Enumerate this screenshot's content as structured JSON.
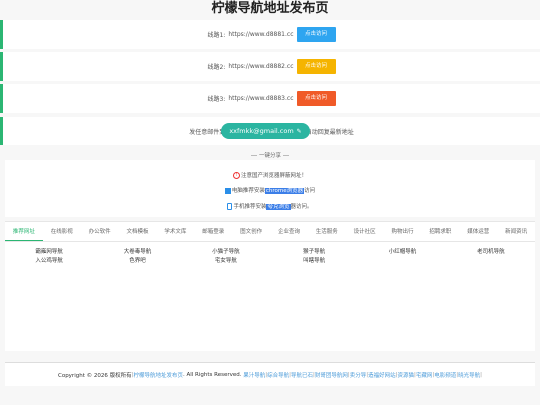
{
  "page_title": "柠檬导航地址发布页",
  "lines": [
    {
      "label": "线路1:",
      "url": "https://www.d8881.cc",
      "button": "点击访问",
      "color": "#2ea5f0"
    },
    {
      "label": "线路2:",
      "url": "https://www.d8882.cc",
      "button": "点击访问",
      "color": "#f5b400"
    },
    {
      "label": "线路3:",
      "url": "https://www.d8883.cc",
      "button": "点击访问",
      "color": "#f05a28"
    }
  ],
  "email": {
    "prefix": "发任意邮件到",
    "address": "xxfmkk@gmail.com",
    "suffix": "自动回复最新地址"
  },
  "share": {
    "title": "一键分享",
    "notice": "注意国产浏览器屏蔽网址！",
    "pc_prefix": "电脑推荐安装",
    "pc_browser": "chrome浏览器",
    "pc_suffix": "访问",
    "phone_prefix": "手机推荐安装",
    "phone_browser": "夸克浏览",
    "phone_suffix": "器访问。"
  },
  "tabs": [
    "推荐网址",
    "在线影视",
    "办公软件",
    "文档模板",
    "学术文库",
    "邮箱登录",
    "图文创作",
    "企业查询",
    "生活服务",
    "设计社区",
    "购物出行",
    "招聘求职",
    "媒体运营",
    "新闻资讯"
  ],
  "links": [
    "霸雍网导航",
    "大卷毒导航",
    "小猫子导航",
    "猴子导航",
    "小红帽导航",
    "老司机导航",
    "入公鸡导航",
    "色界吧",
    "宅女导航",
    "叫瞎导航"
  ],
  "footer": {
    "copyright": "Copyright © 2026 版权所有",
    "site": "柠檬导航地址发布页",
    "rights": ". All Rights Reserved.",
    "links": [
      "果汁导航",
      "综合导航",
      "导航已石",
      "财哥团导航网",
      "卖分导",
      "造福好网站",
      "资源猫",
      "宅藏网",
      "电影频道",
      "晓光导航"
    ]
  }
}
